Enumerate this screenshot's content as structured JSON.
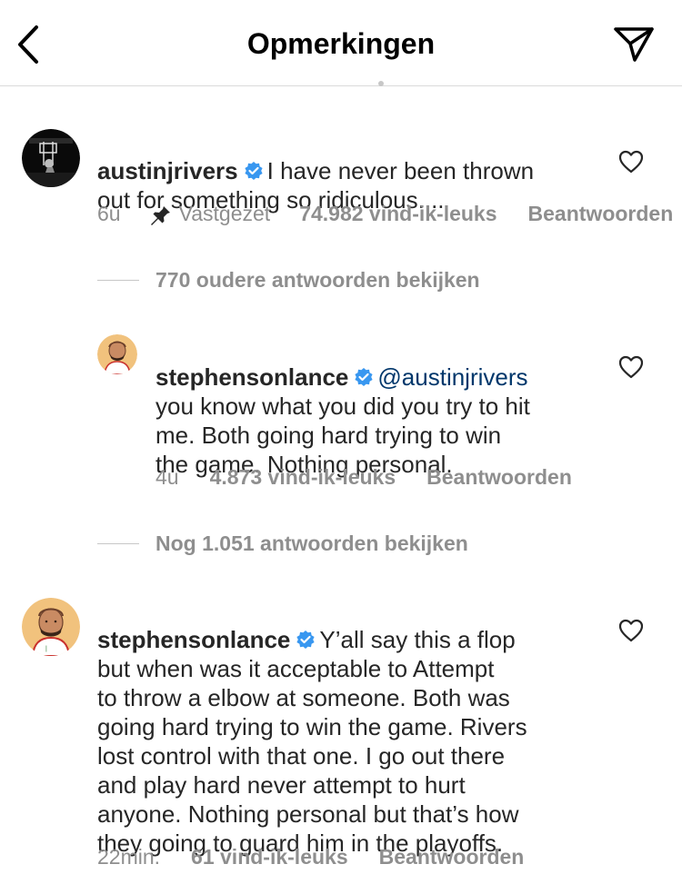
{
  "header": {
    "title": "Opmerkingen",
    "back_icon": "chevron-left-icon",
    "share_icon": "paper-plane-icon"
  },
  "comments": [
    {
      "username": "austinjrivers",
      "verified": true,
      "text": "I have never been thrown\nout for something so ridiculous....",
      "meta": {
        "time": "6u",
        "pinned_label": "Vastgezet",
        "likes": "74.982 vind-ik-leuks",
        "reply": "Beantwoorden"
      }
    },
    {
      "username": "stephensonlance",
      "verified": true,
      "mention": "@austinjrivers",
      "text": "you know what you did you try to hit\nme. Both going hard trying to win\nthe game. Nothing personal.",
      "meta": {
        "time": "4u",
        "likes": "4.873 vind-ik-leuks",
        "reply": "Beantwoorden"
      }
    },
    {
      "username": "stephensonlance",
      "verified": true,
      "text": "Y’all say this a flop\nbut when was it acceptable to Attempt\nto throw a elbow at someone. Both was\ngoing hard trying to win the game. Rivers\nlost control with  that one. I go out there\nand play hard never attempt to hurt\nanyone. Nothing personal but that’s how\nthey going to guard him in the playoffs.",
      "meta": {
        "time": "22min.",
        "likes": "61 vind-ik-leuks",
        "reply": "Beantwoorden"
      }
    }
  ],
  "replies_toggles": [
    "770 oudere antwoorden bekijken",
    "Nog 1.051 antwoorden bekijken"
  ],
  "colors": {
    "verified": "#3897f0",
    "mention": "#00376b",
    "meta": "#8e8e8e"
  }
}
